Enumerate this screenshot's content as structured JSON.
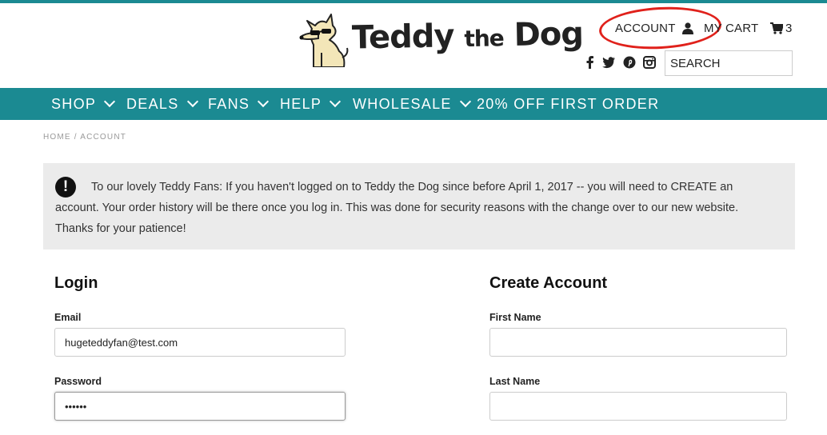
{
  "brand": {
    "name_part1": "Teddy",
    "name_part2": "the",
    "name_part3": "Dog"
  },
  "header": {
    "account_label": "ACCOUNT",
    "cart_label": "MY CART",
    "cart_count": "3",
    "search_placeholder": "SEARCH"
  },
  "social_icons": [
    "facebook-icon",
    "twitter-icon",
    "pinterest-icon",
    "instagram-icon"
  ],
  "nav": {
    "items": [
      {
        "label": "SHOP",
        "has_dropdown": true
      },
      {
        "label": "DEALS",
        "has_dropdown": true
      },
      {
        "label": "FANS",
        "has_dropdown": true
      },
      {
        "label": "HELP",
        "has_dropdown": true
      },
      {
        "label": "WHOLESALE",
        "has_dropdown": true
      },
      {
        "label": "20% OFF FIRST ORDER",
        "has_dropdown": false
      }
    ]
  },
  "breadcrumb": {
    "home": "HOME",
    "separator": "/",
    "current": "ACCOUNT"
  },
  "notice": {
    "text": "To our lovely Teddy Fans: If you haven't logged on to Teddy the Dog since before April 1, 2017 -- you will need to CREATE an account. Your order history will be there once you log in. This was done for security reasons with the change over to our new website. Thanks for your patience!"
  },
  "login": {
    "title": "Login",
    "email_label": "Email",
    "email_value": "hugeteddyfan@test.com",
    "password_label": "Password",
    "password_value": "••••••"
  },
  "create_account": {
    "title": "Create Account",
    "first_name_label": "First Name",
    "first_name_value": "",
    "last_name_label": "Last Name",
    "last_name_value": ""
  },
  "colors": {
    "accent": "#1b8a92",
    "annotation": "#e0211b",
    "notice_bg": "#ebebeb"
  }
}
